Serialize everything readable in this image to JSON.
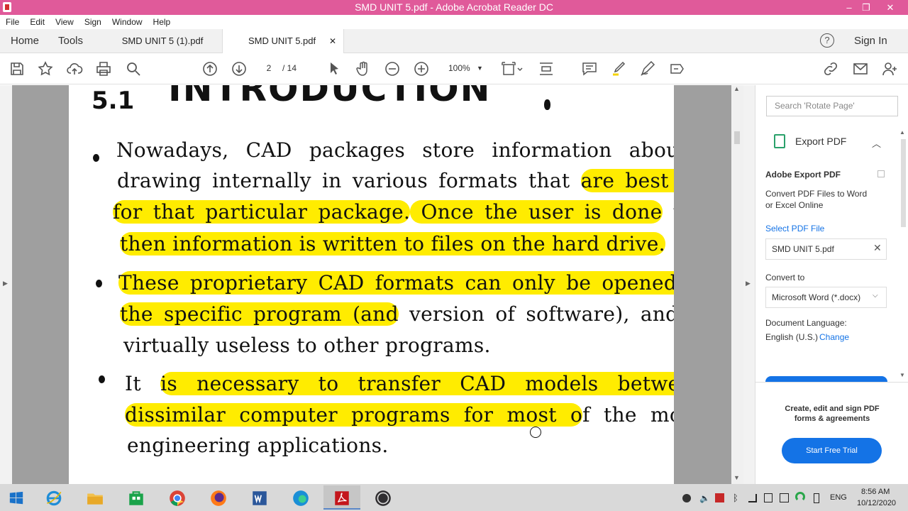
{
  "window": {
    "title": "SMD UNIT 5.pdf - Adobe Acrobat Reader DC",
    "minimize": "–",
    "restore": "❐",
    "close": "✕"
  },
  "menu": [
    "File",
    "Edit",
    "View",
    "Sign",
    "Window",
    "Help"
  ],
  "nav": {
    "home": "Home",
    "tools": "Tools",
    "sign_in": "Sign In",
    "help": "?"
  },
  "tabs": [
    {
      "label": "SMD UNIT 5 (1).pdf"
    },
    {
      "label": "SMD UNIT 5.pdf",
      "close": "✕"
    }
  ],
  "toolbar": {
    "page_current": "2",
    "page_total": "/ 14",
    "zoom": "100%"
  },
  "document": {
    "section_number": "5.1",
    "section_title": "INTRODUCTION",
    "bullets": [
      {
        "lines": [
          {
            "plain": "Nowadays, CAD packages store information about",
            "hl": ""
          },
          {
            "plain": "drawing internally in various formats that ",
            "hl": "are best suited"
          },
          {
            "hl": "for that particular package.",
            "hl2": " Once the user is done",
            "plain": " this"
          },
          {
            "hl": "then information is written to files on the hard drive."
          }
        ]
      },
      {
        "lines": [
          {
            "hl": "These proprietary CAD formats can only be opened by"
          },
          {
            "hl": "the specific program (and",
            "plain": " version of software), and are"
          },
          {
            "plain": "virtually useless to other programs."
          }
        ]
      },
      {
        "lines": [
          {
            "plain": "It ",
            "hl": "is necessary to transfer CAD models between"
          },
          {
            "hl": "dissimilar computer programs for most o",
            "plain": "f the modern"
          },
          {
            "plain": "engineering applications."
          }
        ]
      }
    ]
  },
  "right_panel": {
    "search_placeholder": "Search 'Rotate Page'",
    "export_title": "Export PDF",
    "export_heading": "Adobe Export PDF",
    "export_desc": "Convert PDF Files to Word or Excel Online",
    "select_file": "Select PDF File",
    "file_name": "SMD UNIT 5.pdf",
    "convert_to": "Convert to",
    "convert_option": "Microsoft Word (*.docx)",
    "doc_language": "Document Language:",
    "language": "English (U.S.)",
    "change": "Change",
    "promo": "Create, edit and sign PDF forms & agreements",
    "trial_button": "Start Free Trial"
  },
  "taskbar": {
    "time": "8:56 AM",
    "date": "10/12/2020",
    "lang": "ENG"
  },
  "colors": {
    "title_bar": "#e05a9a",
    "highlight": "#ffec00",
    "accent": "#1473e6"
  }
}
